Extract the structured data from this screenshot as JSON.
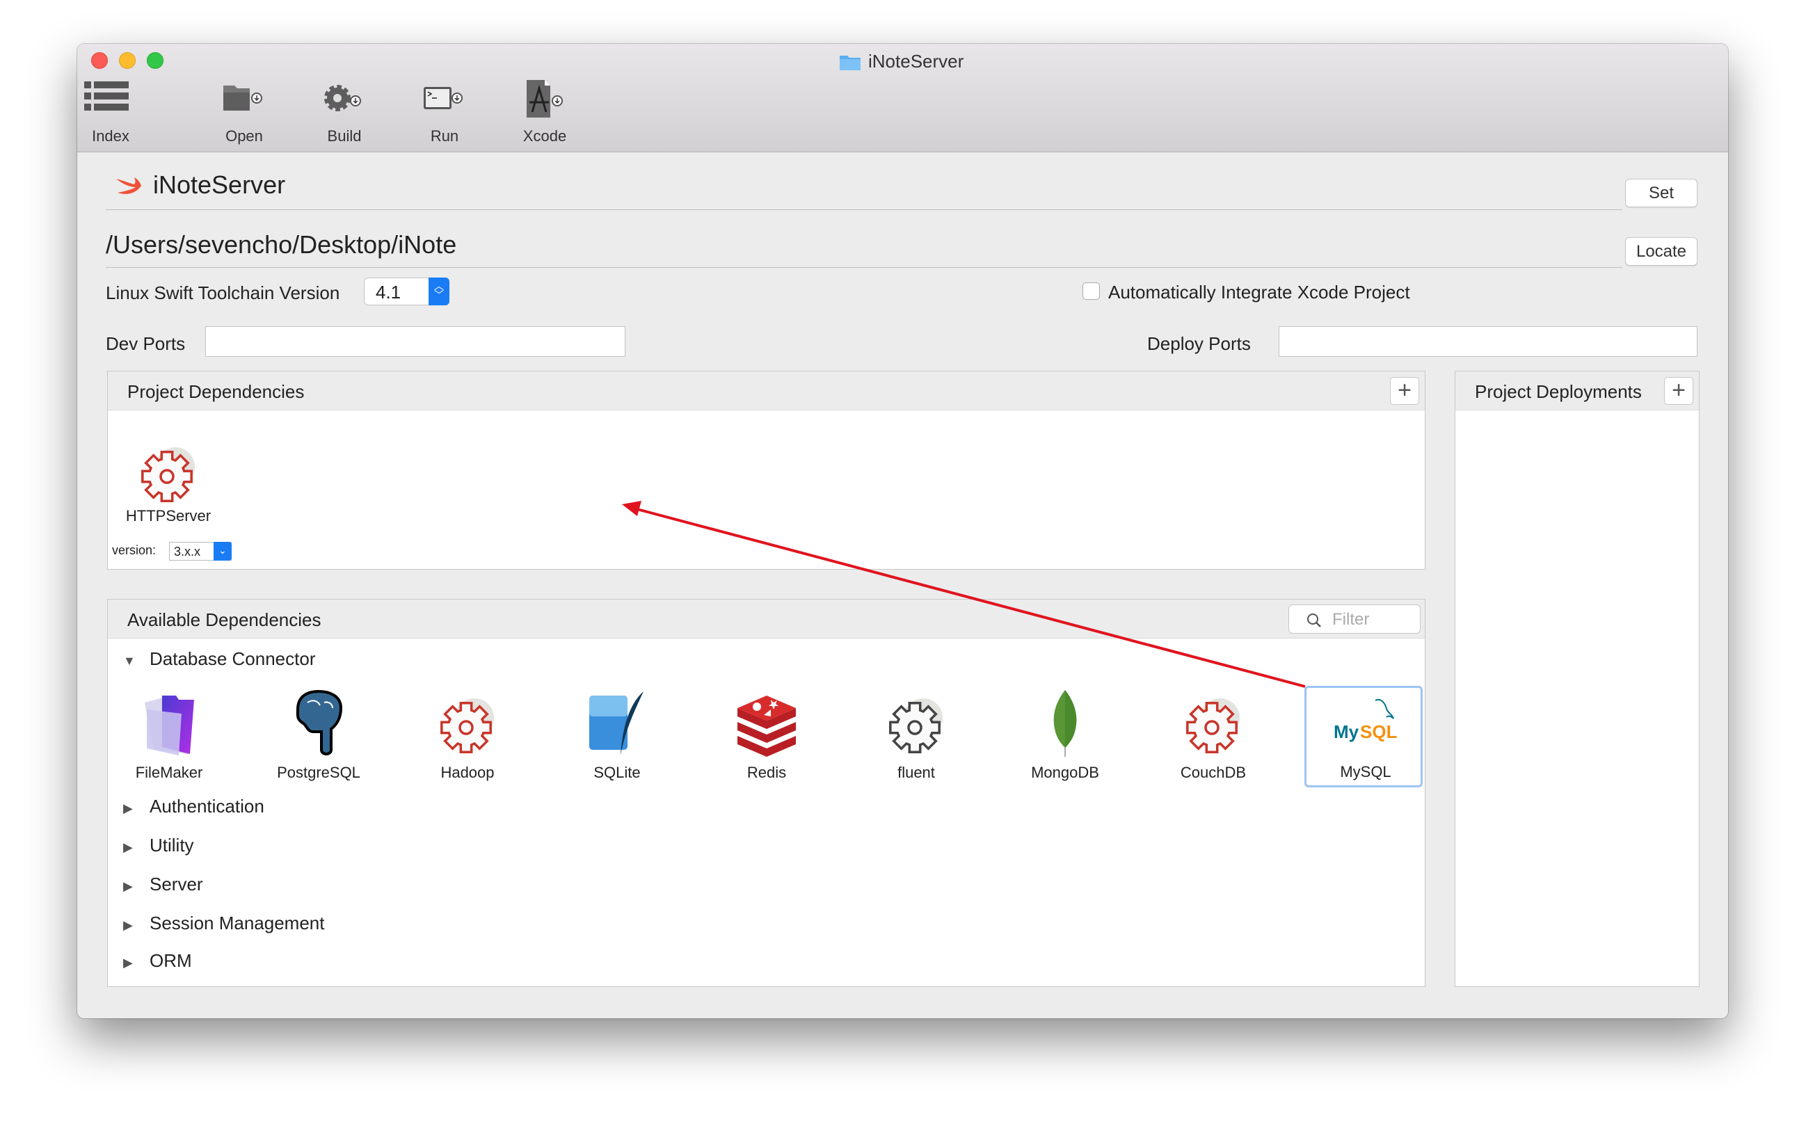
{
  "window": {
    "title": "iNoteServer"
  },
  "toolbar": {
    "items": [
      {
        "label": "Index",
        "icon": "list-icon"
      },
      {
        "label": "Open",
        "icon": "folder-icon"
      },
      {
        "label": "Build",
        "icon": "gear-icon"
      },
      {
        "label": "Run",
        "icon": "terminal-icon"
      },
      {
        "label": "Xcode",
        "icon": "xcode-icon"
      }
    ]
  },
  "project": {
    "name": "iNoteServer",
    "set_label": "Set",
    "path": "/Users/sevencho/Desktop/iNote",
    "locate_label": "Locate"
  },
  "toolchain": {
    "label": "Linux Swift Toolchain Version",
    "value": "4.1"
  },
  "xcode_integration": {
    "label": "Automatically Integrate Xcode Project",
    "checked": false
  },
  "ports": {
    "dev_label": "Dev Ports",
    "dev_value": "",
    "deploy_label": "Deploy Ports",
    "deploy_value": ""
  },
  "project_dependencies": {
    "title": "Project Dependencies",
    "add": "+",
    "items": [
      {
        "name": "HTTPServer",
        "version_label": "version:",
        "version": "3.x.x"
      }
    ]
  },
  "project_deployments": {
    "title": "Project Deployments",
    "add": "+"
  },
  "available_dependencies": {
    "title": "Available Dependencies",
    "filter_placeholder": "Filter",
    "categories": [
      {
        "name": "Database Connector",
        "expanded": true,
        "items": [
          "FileMaker",
          "PostgreSQL",
          "Hadoop",
          "SQLite",
          "Redis",
          "fluent",
          "MongoDB",
          "CouchDB",
          "MySQL"
        ],
        "selected": "MySQL"
      },
      {
        "name": "Authentication"
      },
      {
        "name": "Utility"
      },
      {
        "name": "Server"
      },
      {
        "name": "Session Management"
      },
      {
        "name": "ORM"
      }
    ]
  },
  "colors": {
    "accent": "#1a7cf5",
    "arrow": "#e0141e",
    "selection": "#9cc4f2",
    "gear_red": "#c8352a"
  }
}
